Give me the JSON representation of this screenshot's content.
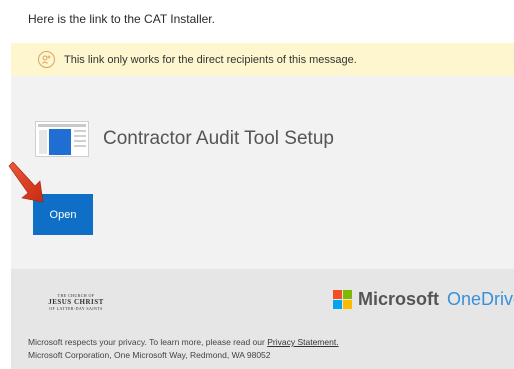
{
  "intro_text": "Here is the link to the CAT Installer.",
  "notice": {
    "icon": "link-restricted-icon",
    "text": "This link only works for the direct recipients of this message."
  },
  "file": {
    "name": "Contractor Audit Tool Setup",
    "icon": "document-thumbnail-icon"
  },
  "open_button": {
    "label": "Open"
  },
  "annotation": {
    "icon": "red-arrow-icon",
    "color": "#d9381e"
  },
  "footer": {
    "church_logo": {
      "line1": "THE CHURCH OF",
      "line2": "JESUS CHRIST",
      "line3": "OF LATTER-DAY SAINTS"
    },
    "brand": {
      "microsoft": "Microsoft",
      "onedrive": "OneDrive",
      "squares_colors": [
        "#f25022",
        "#7fba00",
        "#00a4ef",
        "#ffb900"
      ]
    },
    "privacy": {
      "prefix": "Microsoft respects your privacy. To learn more, please read our ",
      "link_text": "Privacy Statement.",
      "address": "Microsoft Corporation, One Microsoft Way, Redmond, WA 98052"
    }
  },
  "colors": {
    "notice_bg": "#fdf6cf",
    "card_bg": "#f2f2f2",
    "footer_bg": "#e6e6e6",
    "button_bg": "#0f6fc6",
    "onedrive_blue": "#3a8fd9"
  }
}
